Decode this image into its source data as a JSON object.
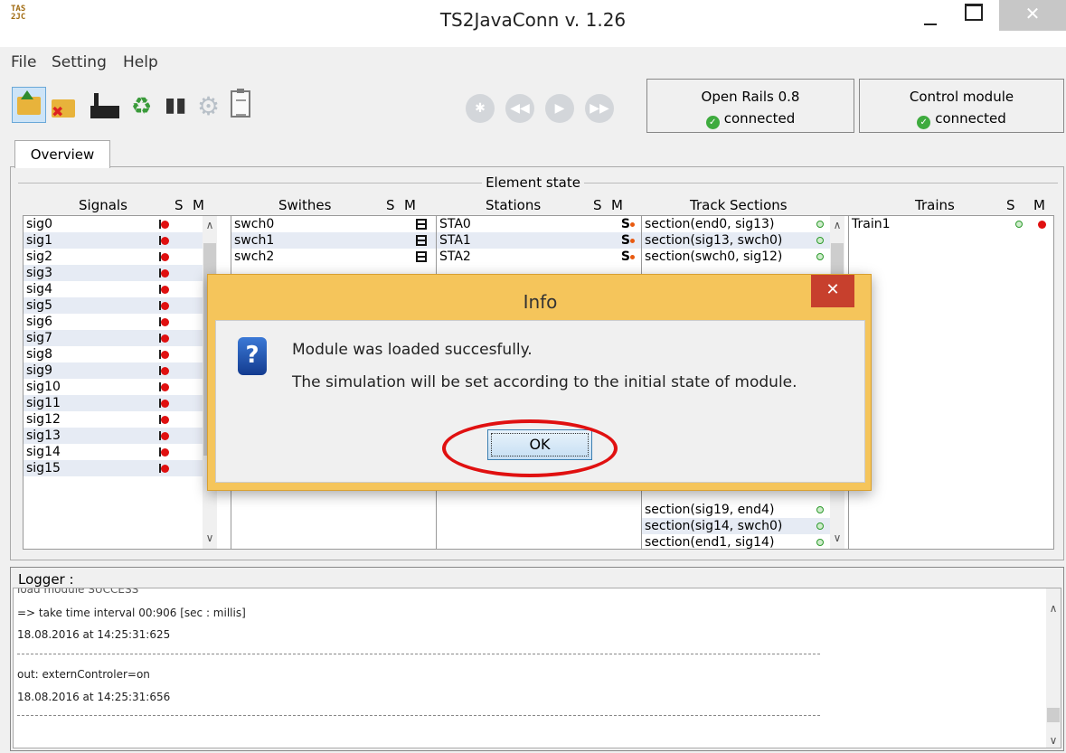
{
  "window": {
    "title": "TS2JavaConn v. 1.26",
    "logo": "TAS 2JC",
    "close_glyph": "✕"
  },
  "menu": {
    "items": [
      "File",
      "Setting",
      "Help"
    ]
  },
  "status": {
    "openrails": {
      "name": "Open Rails 0.8",
      "state": "connected"
    },
    "control": {
      "name": "Control module",
      "state": "connected"
    }
  },
  "tabs": {
    "overview": "Overview"
  },
  "element_state": {
    "title": "Element state",
    "signals_header": "Signals",
    "switches_header": "Swithes",
    "stations_header": "Stations",
    "tracks_header": "Track Sections",
    "trains_header": "Trains",
    "s": "S",
    "m": "M",
    "signals": [
      "sig0",
      "sig1",
      "sig2",
      "sig3",
      "sig4",
      "sig5",
      "sig6",
      "sig7",
      "sig8",
      "sig9",
      "sig10",
      "sig11",
      "sig12",
      "sig13",
      "sig14",
      "sig15"
    ],
    "switches": [
      "swch0",
      "swch1",
      "swch2"
    ],
    "stations": [
      "STA0",
      "STA1",
      "STA2"
    ],
    "tracks_top": [
      "section(end0, sig13)",
      "section(sig13, swch0)",
      "section(swch0, sig12)"
    ],
    "tracks_bottom": [
      "section(sig19, end4)",
      "section(sig14, swch0)",
      "section(end1, sig14)"
    ],
    "trains": [
      "Train1"
    ],
    "station_glyph": "S"
  },
  "dialog": {
    "title": "Info",
    "close_glyph": "✕",
    "icon_glyph": "?",
    "line1": "Module was loaded succesfully.",
    "line2": "The simulation will be set according to the initial state of module.",
    "ok_label": "OK"
  },
  "logger": {
    "label": "Logger :",
    "lines": [
      "load module    SUCCESS",
      "=> take time interval 00:906  [sec : millis]",
      "18.08.2016 at 14:25:31:625",
      "out: externControler=on",
      "18.08.2016 at 14:25:31:656"
    ]
  },
  "glyphs": {
    "up": "∧",
    "down": "∨",
    "recycle": "♻",
    "binoculars": "▮▮",
    "gear": "⚙",
    "rewind": "◀◀",
    "play": "▶",
    "ffwd": "▶▶",
    "settings": "✱",
    "check": "✓"
  }
}
